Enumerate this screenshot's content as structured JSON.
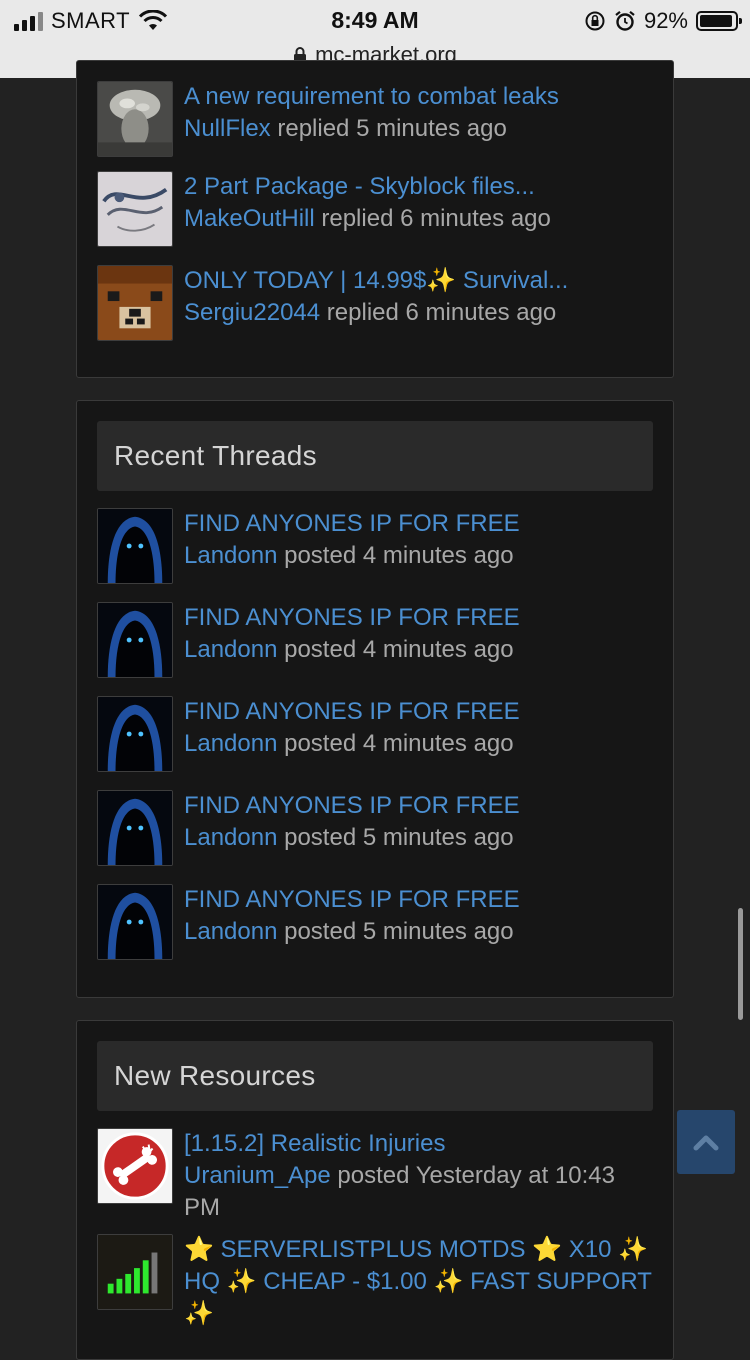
{
  "status_bar": {
    "carrier": "SMART",
    "time": "8:49 AM",
    "battery": "92%",
    "url": "mc-market.org"
  },
  "recent_posts": [
    {
      "title": "A new requirement to combat leaks",
      "user": "NullFlex",
      "action": " replied ",
      "time": "5 minutes ago",
      "avatar": "gray-sculpture-avatar"
    },
    {
      "title": "2 Part Package - Skyblock files...",
      "user": "MakeOutHill",
      "action": " replied ",
      "time": "6 minutes ago",
      "avatar": "sketch-avatar"
    },
    {
      "title": "ONLY TODAY | 14.99$✨ Survival...",
      "user": "Sergiu22044",
      "action": " replied ",
      "time": "6 minutes ago",
      "avatar": "bear-avatar"
    }
  ],
  "recent_threads": {
    "heading": "Recent Threads",
    "items": [
      {
        "title": "FIND ANYONES IP FOR FREE",
        "user": "Landonn",
        "action": " posted ",
        "time": "4 minutes ago"
      },
      {
        "title": "FIND ANYONES IP FOR FREE",
        "user": "Landonn",
        "action": " posted ",
        "time": "4 minutes ago"
      },
      {
        "title": "FIND ANYONES IP FOR FREE",
        "user": "Landonn",
        "action": " posted ",
        "time": "4 minutes ago"
      },
      {
        "title": "FIND ANYONES IP FOR FREE",
        "user": "Landonn",
        "action": " posted ",
        "time": "5 minutes ago"
      },
      {
        "title": "FIND ANYONES IP FOR FREE",
        "user": "Landonn",
        "action": " posted ",
        "time": "5 minutes ago"
      }
    ]
  },
  "new_resources": {
    "heading": "New Resources",
    "items": [
      {
        "title": "[1.15.2] Realistic Injuries",
        "user": "Uranium_Ape",
        "action": " posted ",
        "time": "Yesterday at 10:43 PM"
      },
      {
        "title": "⭐ SERVERLISTPLUS MOTDS ⭐ X10 ✨ HQ ✨ CHEAP - $1.00 ✨ FAST SUPPORT ✨"
      }
    ]
  },
  "colors": {
    "link": "#4b8fd1",
    "page_background": "#222222",
    "panel_background": "#161616"
  }
}
